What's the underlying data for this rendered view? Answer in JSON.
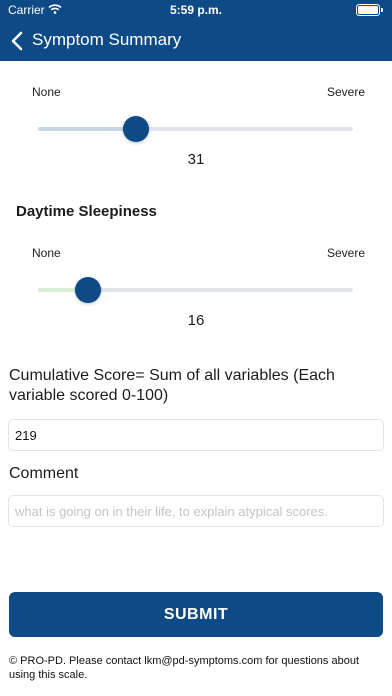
{
  "status_bar": {
    "carrier": "Carrier",
    "time": "5:59 p.m."
  },
  "nav": {
    "back_icon": "chevron-left-icon",
    "title": "Symptom Summary"
  },
  "slider_1": {
    "min_label": "None",
    "max_label": "Severe",
    "value": 31,
    "value_text": "31",
    "fill_color": "#c9d6e8"
  },
  "slider_2": {
    "title": "Daytime Sleepiness",
    "min_label": "None",
    "max_label": "Severe",
    "value": 16,
    "value_text": "16",
    "fill_color": "#dcefd6"
  },
  "cumulative": {
    "label": "Cumulative Score= Sum of all variables (Each variable scored 0-100)",
    "value": "219"
  },
  "comment": {
    "label": "Comment",
    "placeholder": "what is going on in their life, to explain atypical scores.",
    "value": ""
  },
  "submit_label": "SUBMIT",
  "footer": "© PRO-PD. Please contact lkm@pd-symptoms.com for questions about using this scale.",
  "colors": {
    "primary": "#0d4a86"
  }
}
